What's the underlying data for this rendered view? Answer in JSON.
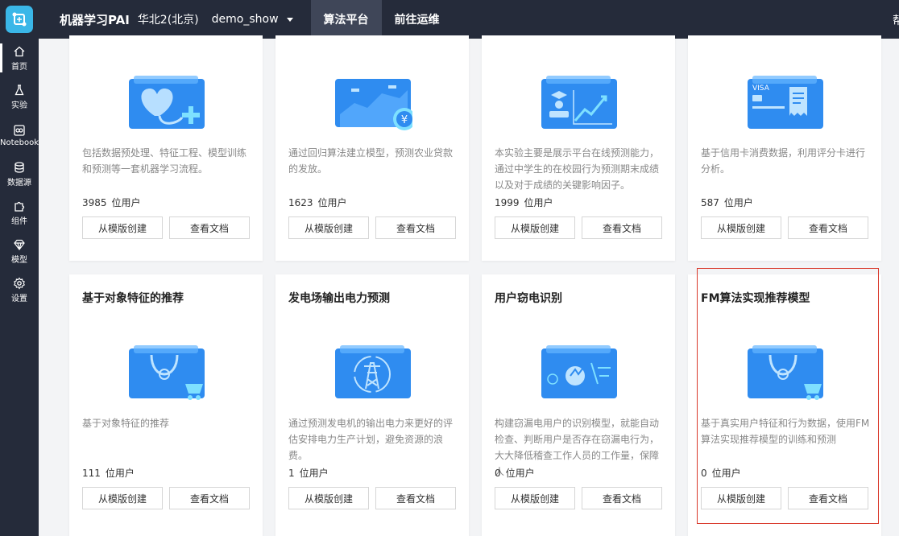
{
  "header": {
    "app_title": "机器学习PAI",
    "region": "华北2(北京)",
    "workspace": "demo_show",
    "tabs": [
      {
        "label": "算法平台",
        "active": true
      },
      {
        "label": "前往运维",
        "active": false
      }
    ],
    "help_label": "帮"
  },
  "sidebar": {
    "items": [
      {
        "label": "首页",
        "icon": "home-icon",
        "active": true
      },
      {
        "label": "实验",
        "icon": "flask-icon",
        "active": false
      },
      {
        "label": "Notebook",
        "icon": "notebook-icon",
        "active": false
      },
      {
        "label": "数据源",
        "icon": "database-icon",
        "active": false
      },
      {
        "label": "组件",
        "icon": "puzzle-icon",
        "active": false
      },
      {
        "label": "模型",
        "icon": "diamond-icon",
        "active": false
      },
      {
        "label": "设置",
        "icon": "gear-icon",
        "active": false
      }
    ]
  },
  "cards": [
    {
      "title": "",
      "desc": "包括数据预处理、特征工程、模型训练和预测等一套机器学习流程。",
      "users": "3985",
      "icon": "heart-health-icon"
    },
    {
      "title": "",
      "desc": "通过回归算法建立模型，预测农业贷款的发放。",
      "users": "1623",
      "icon": "yuan-chart-icon"
    },
    {
      "title": "",
      "desc": "本实验主要是展示平台在线预测能力，通过中学生的在校园行为预测期末成绩以及对于成绩的关键影响因子。",
      "users": "1999",
      "icon": "student-chart-icon"
    },
    {
      "title": "",
      "desc": "基于信用卡消费数据，利用评分卡进行分析。",
      "users": "587",
      "icon": "credit-card-icon"
    },
    {
      "title": "基于对象特征的推荐",
      "desc": "基于对象特征的推荐",
      "users": "111",
      "icon": "shopping-bag-icon"
    },
    {
      "title": "发电场输出电力预测",
      "desc": "通过预测发电机的输出电力来更好的评估安排电力生产计划，避免资源的浪费。",
      "users": "1",
      "icon": "power-tower-icon"
    },
    {
      "title": "用户窃电识别",
      "desc": "构建窃漏电用户的识别模型，就能自动检查、判断用户是否存在窃漏电行为，大大降低稽查工作人员的工作量，保障人",
      "users": "0",
      "icon": "power-theft-icon"
    },
    {
      "title": "FM算法实现推荐模型",
      "desc": "基于真实用户特征和行为数据，使用FM算法实现推荐模型的训练和预测",
      "users": "0",
      "icon": "shopping-bag-icon"
    }
  ],
  "labels": {
    "users_unit": "位用户",
    "create_button": "从模版创建",
    "docs_button": "查看文档"
  },
  "colors": {
    "topbar": "#252b3a",
    "active_tab": "#3f4658",
    "illustration_blue": "#2f8cf0",
    "highlight_border": "#d9392b"
  }
}
